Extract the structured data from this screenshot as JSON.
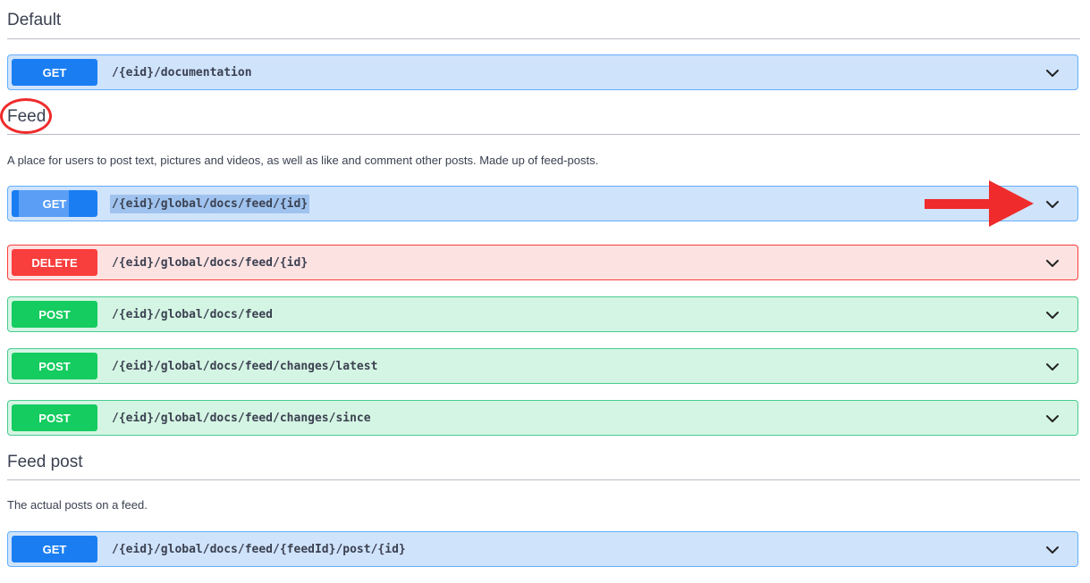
{
  "sections": [
    {
      "title": "Default",
      "description": "",
      "operations": [
        {
          "method": "GET",
          "path": "/{eid}/documentation"
        }
      ]
    },
    {
      "title": "Feed",
      "description": "A place for users to post text, pictures and videos, as well as like and comment other posts. Made up of feed-posts.",
      "operations": [
        {
          "method": "GET",
          "path": "/{eid}/global/docs/feed/{id}"
        },
        {
          "method": "DELETE",
          "path": "/{eid}/global/docs/feed/{id}"
        },
        {
          "method": "POST",
          "path": "/{eid}/global/docs/feed"
        },
        {
          "method": "POST",
          "path": "/{eid}/global/docs/feed/changes/latest"
        },
        {
          "method": "POST",
          "path": "/{eid}/global/docs/feed/changes/since"
        }
      ]
    },
    {
      "title": "Feed post",
      "description": "The actual posts on a feed.",
      "operations": [
        {
          "method": "GET",
          "path": "/{eid}/global/docs/feed/{feedId}/post/{id}"
        }
      ]
    }
  ],
  "icons": {
    "expand": "chevron-down-icon",
    "annotation_arrow": "arrow-right-icon",
    "annotation_circle": "circle-highlight"
  },
  "colors": {
    "get_bg": "#cfe3fb",
    "get_method": "#1a7ef2",
    "delete_bg": "#fde2e2",
    "delete_method": "#f93e3e",
    "post_bg": "#d4f5e3",
    "post_method": "#14cc5f",
    "annotation": "#ef2b2b"
  }
}
